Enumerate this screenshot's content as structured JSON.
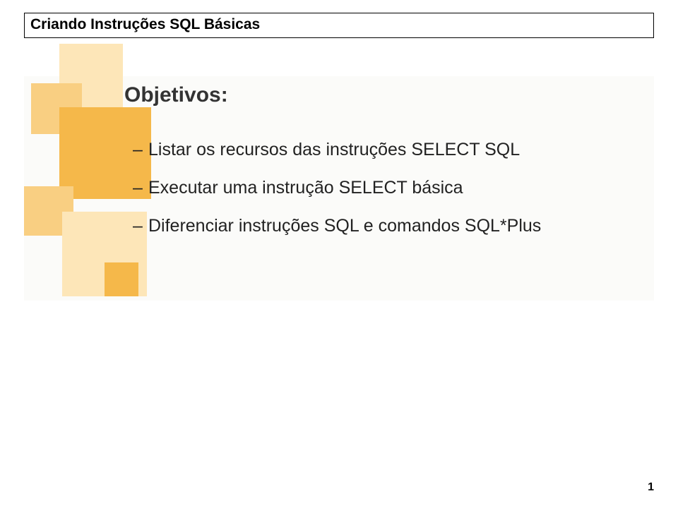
{
  "header": {
    "title": "Criando Instruções SQL Básicas"
  },
  "content": {
    "heading": "Objetivos:",
    "bullets": [
      "Listar os recursos das instruções SELECT SQL",
      "Executar uma instrução SELECT básica",
      "Diferenciar instruções SQL e comandos SQL*Plus"
    ]
  },
  "page_number": "1"
}
